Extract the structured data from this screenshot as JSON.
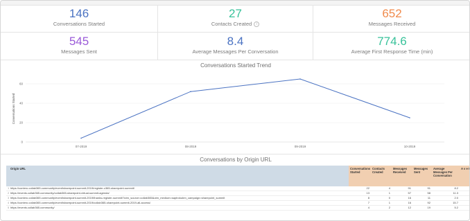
{
  "kpis": [
    {
      "value": "146",
      "label": "Conversations Started",
      "color": "#4a72c2",
      "has_info": false
    },
    {
      "value": "27",
      "label": "Contacts Created",
      "color": "#38c29a",
      "has_info": true
    },
    {
      "value": "652",
      "label": "Messages Received",
      "color": "#f08a4b",
      "has_info": false
    },
    {
      "value": "545",
      "label": "Messages Sent",
      "color": "#9a5ad8",
      "has_info": false
    },
    {
      "value": "8.4",
      "label": "Average Messages Per Conversation",
      "color": "#4a72c2",
      "has_info": false
    },
    {
      "value": "774.6",
      "label": "Average First Response Time (min)",
      "color": "#38c29a",
      "has_info": false
    }
  ],
  "trend": {
    "title": "Conversations Started Trend",
    "chart_data": {
      "type": "line",
      "categories": [
        "07-2019",
        "08-2019",
        "09-2019",
        "10-2019"
      ],
      "series": [
        {
          "values": [
            4,
            52,
            65,
            25
          ]
        }
      ],
      "ylabel": "Conversations Started",
      "yticks": [
        0,
        20,
        40,
        60
      ],
      "ylim": [
        0,
        70
      ],
      "line_color": "#4a72c2"
    }
  },
  "origin": {
    "title": "Conversations by Origin URL",
    "columns": [
      "Origin URL",
      "Conversations Started",
      "Contacts Created",
      "Messages Received",
      "Messages Sent",
      "Average Messages Per Conversation",
      "A v e F R T (m"
    ],
    "rows": [
      {
        "idx": "1",
        "url": "https://contero.collab365.community/event/sharepoint-summit-2019/register-c365-sharepoint-summit/",
        "cols": [
          "22",
          "4",
          "91",
          "91",
          "8.2",
          ""
        ]
      },
      {
        "idx": "2",
        "url": "https://events.collab365.community/collab365-sharepoint-virtual-summit-agenda/",
        "cols": [
          "13",
          "1",
          "57",
          "58",
          "11.3",
          ""
        ]
      },
      {
        "idx": "3",
        "url": "https://contero.collab365.community/event/sharepoint-summit-2019/thanks-register-summit/?utm_source=collab365&utm_medium=saptrokubm_campaign=sharepoint_summit",
        "cols": [
          "8",
          "0",
          "16",
          "11",
          "2.0",
          ""
        ]
      },
      {
        "idx": "4",
        "url": "https://contero.collab365.community/event/sharepoint-summit-2019/collab365-sharepoint-summit-2019-all-access/",
        "cols": [
          "7",
          "1",
          "16",
          "92",
          "15.7",
          ""
        ]
      },
      {
        "idx": "5",
        "url": "https://events.collab365.community/",
        "cols": [
          "4",
          "2",
          "12",
          "19",
          "5.2",
          ""
        ]
      }
    ]
  }
}
